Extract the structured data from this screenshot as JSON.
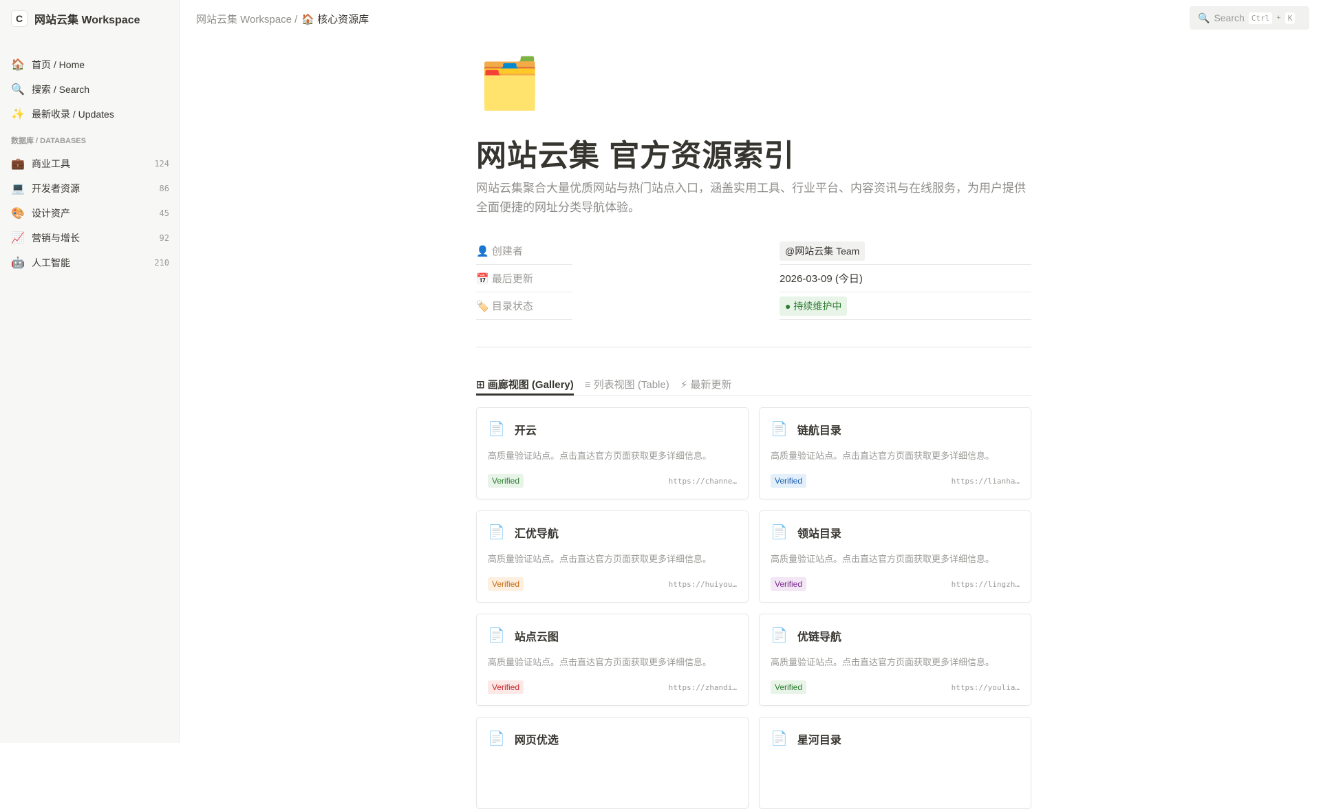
{
  "workspace": {
    "logo": "C",
    "name": "网站云集 Workspace"
  },
  "nav": [
    {
      "icon": "🏠",
      "label": "首页 / Home"
    },
    {
      "icon": "🔍",
      "label": "搜索 / Search"
    },
    {
      "icon": "✨",
      "label": "最新收录 / Updates"
    }
  ],
  "databases_heading": "数据库 / DATABASES",
  "databases": [
    {
      "icon": "💼",
      "label": "商业工具",
      "count": "124"
    },
    {
      "icon": "💻",
      "label": "开发者资源",
      "count": "86"
    },
    {
      "icon": "🎨",
      "label": "设计资产",
      "count": "45"
    },
    {
      "icon": "📈",
      "label": "营销与增长",
      "count": "92"
    },
    {
      "icon": "🤖",
      "label": "人工智能",
      "count": "210"
    }
  ],
  "breadcrumb": {
    "root": "网站云集 Workspace /",
    "current": "🏠 核心资源库"
  },
  "search": {
    "icon": "🔍",
    "label": "Search",
    "key1": "Ctrl",
    "plus": "+",
    "key2": "K"
  },
  "page": {
    "icon": "🗂️",
    "title": "网站云集 官方资源索引",
    "description": "网站云集聚合大量优质网站与热门站点入口，涵盖实用工具、行业平台、内容资讯与在线服务，为用户提供全面便捷的网址分类导航体验。"
  },
  "properties": [
    {
      "label": "👤 创建者",
      "value": "@网站云集 Team",
      "type": "chip"
    },
    {
      "label": "📅 最后更新",
      "value": "2026-03-09 (今日)",
      "type": "text"
    },
    {
      "label": "🏷️ 目录状态",
      "value": "● 持续维护中",
      "type": "status"
    }
  ],
  "tabs": [
    {
      "label": "⊞ 画廊视图 (Gallery)",
      "active": true
    },
    {
      "label": "≡ 列表视图 (Table)"
    },
    {
      "label": "⚡ 最新更新"
    }
  ],
  "cards": [
    {
      "title": "开云",
      "desc": "高质量验证站点。点击直达官方页面获取更多详细信息。",
      "badge": "Verified",
      "url": "https://channe…",
      "bg": "#e8f4e8",
      "fg": "#2e7d32"
    },
    {
      "title": "链航目录",
      "desc": "高质量验证站点。点击直达官方页面获取更多详细信息。",
      "badge": "Verified",
      "url": "https://lianha…",
      "bg": "#e3f0fb",
      "fg": "#1f5fae"
    },
    {
      "title": "汇优导航",
      "desc": "高质量验证站点。点击直达官方页面获取更多详细信息。",
      "badge": "Verified",
      "url": "https://huiyou…",
      "bg": "#fdf0e0",
      "fg": "#c86a10"
    },
    {
      "title": "领站目录",
      "desc": "高质量验证站点。点击直达官方页面获取更多详细信息。",
      "badge": "Verified",
      "url": "https://lingzh…",
      "bg": "#f3e6f5",
      "fg": "#7b2d8c"
    },
    {
      "title": "站点云图",
      "desc": "高质量验证站点。点击直达官方页面获取更多详细信息。",
      "badge": "Verified",
      "url": "https://zhandi…",
      "bg": "#fde8e8",
      "fg": "#c62828"
    },
    {
      "title": "优链导航",
      "desc": "高质量验证站点。点击直达官方页面获取更多详细信息。",
      "badge": "Verified",
      "url": "https://youlia…",
      "bg": "#e8f4e8",
      "fg": "#2e7d32"
    },
    {
      "title": "网页优选",
      "desc": "",
      "badge": "",
      "url": "",
      "bg": "#fff",
      "fg": "#fff"
    },
    {
      "title": "星河目录",
      "desc": "",
      "badge": "",
      "url": "",
      "bg": "#fff",
      "fg": "#fff"
    }
  ]
}
